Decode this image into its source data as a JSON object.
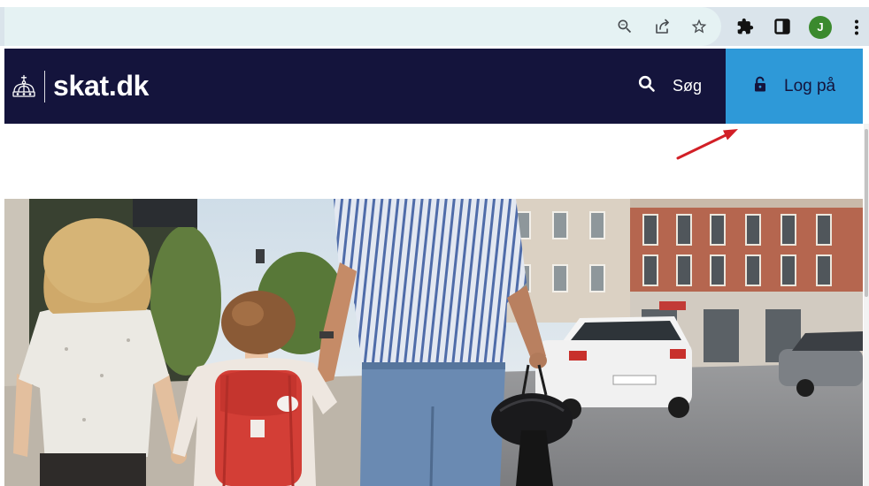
{
  "browser": {
    "omnibox_icons": [
      "zoom-out-icon",
      "share-icon",
      "star-icon"
    ],
    "toolbar_icons": [
      "extensions-icon",
      "side-panel-icon",
      "profile-avatar",
      "menu-icon"
    ],
    "avatar_initial": "J",
    "avatar_color": "#3b8a2e"
  },
  "header": {
    "logo_icon": "crown-icon",
    "logo_text": "skat.dk",
    "search_icon": "search-icon",
    "search_label": "Søg",
    "login_icon": "lock-icon",
    "login_label": "Log på"
  },
  "colors": {
    "header_bg": "#14143c",
    "login_bg": "#2e99d8",
    "login_text": "#14143c",
    "annotation_arrow": "#d21f26"
  }
}
